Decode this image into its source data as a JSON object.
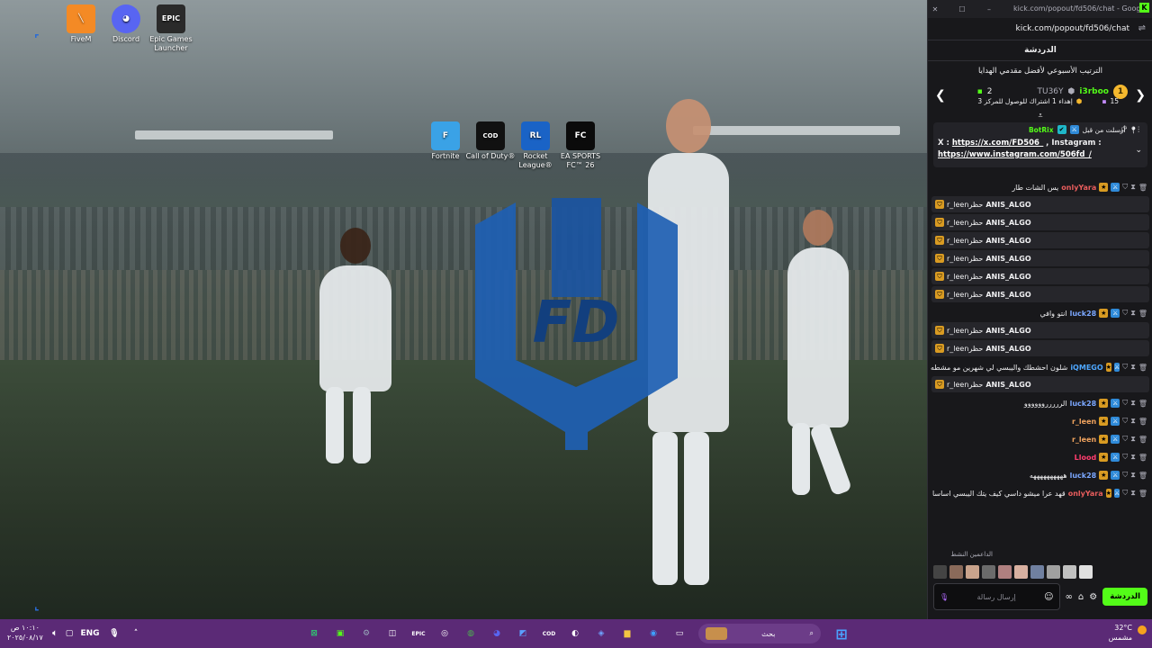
{
  "desktop_icons": [
    {
      "label": "FiveM",
      "name": "fivem-icon",
      "color": "#f48a25",
      "glyph": "╲"
    },
    {
      "label": "Discord",
      "name": "discord-icon",
      "color": "#5865f2",
      "glyph": "◕"
    },
    {
      "label": "Epic Games Launcher",
      "name": "epic-games-icon",
      "color": "#2a2a2a",
      "glyph": "EPIC"
    },
    {
      "label": "Fortnite",
      "name": "fortnite-icon",
      "color": "#3aa2e6",
      "glyph": "F"
    },
    {
      "label": "Call of Duty®",
      "name": "call-of-duty-icon",
      "color": "#111111",
      "glyph": "COD"
    },
    {
      "label": "Rocket League®",
      "name": "rocket-league-icon",
      "color": "#1a63c6",
      "glyph": "RL"
    },
    {
      "label": "EA SPORTS FC™ 26",
      "name": "ea-fc-icon",
      "color": "#0b0b0b",
      "glyph": "FC"
    }
  ],
  "window": {
    "title": "kick.com/popout/fd506/chat - Googl...",
    "url": "kick.com/popout/fd506/chat"
  },
  "chat": {
    "header": "الدردشة",
    "leaderboard_title": "الترتيب الأسبوعي لأفضل مقدمي الهدايا",
    "leaderboard": {
      "first_name": "i3rboo",
      "first_rank": "1",
      "first_count": "15",
      "second_name": "TU36Y",
      "second_count": "2",
      "note": "إهداء 1 اشتراك للوصول للمركز 3"
    },
    "pinned": {
      "sender": "BotRix",
      "sent_by": "أرسلت من قبل",
      "text_prefix": "X : ",
      "link1": "https://x.com/FD506_",
      "text_mid": " , Instagram :",
      "link2": "https://www.instagram.com/506fd_/"
    },
    "messages": [
      {
        "user": "onlyYara",
        "text": "يس الشات طار",
        "color": "#e85d5d",
        "type": "user"
      },
      {
        "user": "ANIS_ALGO",
        "text": "r_leenحظر",
        "type": "mod"
      },
      {
        "user": "ANIS_ALGO",
        "text": "r_leenحظر",
        "type": "mod"
      },
      {
        "user": "ANIS_ALGO",
        "text": "r_leenحظر",
        "type": "mod"
      },
      {
        "user": "ANIS_ALGO",
        "text": "r_leenحظر",
        "type": "mod"
      },
      {
        "user": "ANIS_ALGO",
        "text": "r_leenحظر",
        "type": "mod"
      },
      {
        "user": "ANIS_ALGO",
        "text": "r_leenحظر",
        "type": "mod"
      },
      {
        "user": "luck28",
        "text": "انتو وافي",
        "color": "#7ba7ff",
        "type": "user"
      },
      {
        "user": "ANIS_ALGO",
        "text": "r_leenحظر",
        "type": "mod"
      },
      {
        "user": "ANIS_ALGO",
        "text": "r_leenحظر",
        "type": "mod"
      },
      {
        "user": "iQMEGO",
        "text": "شلون احشطك واليبسي لي شهرين مو مشطه",
        "color": "#4ea7ff",
        "type": "user"
      },
      {
        "user": "ANIS_ALGO",
        "text": "r_leenحظر",
        "type": "mod"
      },
      {
        "user": "luck28",
        "text": "الررررروووووو",
        "color": "#7ba7ff",
        "type": "user"
      },
      {
        "user": "r_leen",
        "text": "",
        "color": "#f0a35e",
        "type": "user"
      },
      {
        "user": "r_leen",
        "text": "",
        "color": "#f0a35e",
        "type": "user"
      },
      {
        "user": "Llood",
        "text": "",
        "color": "#ff3d6e",
        "type": "user"
      },
      {
        "user": "luck28",
        "text": "ههههههههههه",
        "color": "#7ba7ff",
        "type": "user"
      },
      {
        "user": "onlyYara",
        "text": "قهد عرا ميشو داسي كيف يتك اليبسي اساسا",
        "color": "#e85d5d",
        "type": "user"
      }
    ],
    "top_viewers_label": "الداعمين النشط",
    "send_label": "الدردشة",
    "input_placeholder": "إرسال رسالة"
  },
  "taskbar": {
    "weather_temp": "32°C",
    "weather_desc": "مشمس",
    "search_placeholder": "بحث",
    "language": "ENG",
    "time": "١٠:١٠ ص",
    "date": "٢٠٢٥/٠٨/١٧"
  }
}
